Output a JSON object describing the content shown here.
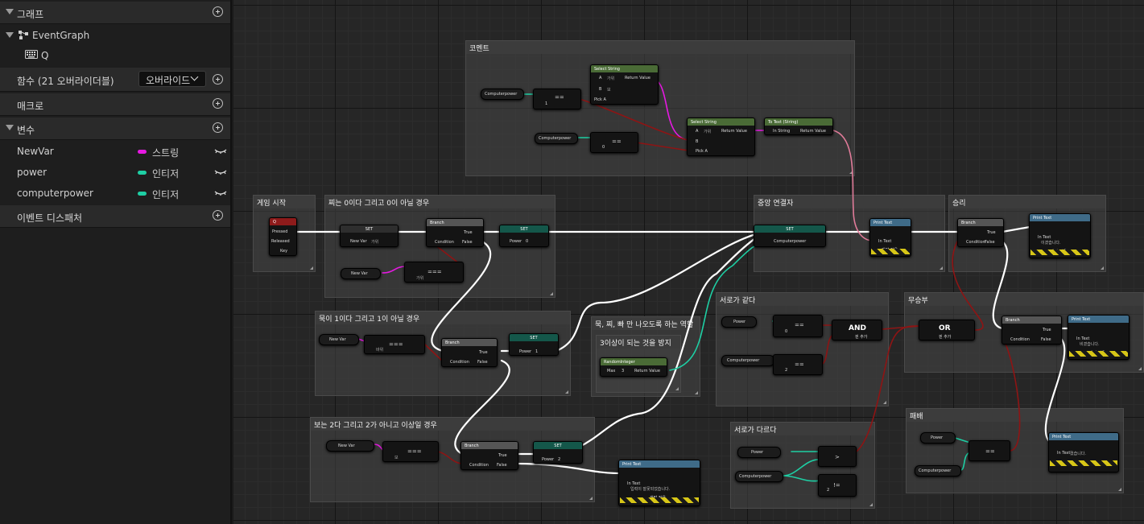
{
  "sidebar": {
    "graph_section": "그래프",
    "event_graph": "EventGraph",
    "q_event": "Q",
    "functions_section": "함수 (21 오버라이더블)",
    "override_label": "오버라이드",
    "macros_section": "매크로",
    "variables_section": "변수",
    "variables": [
      {
        "name": "NewVar",
        "type": "스트링",
        "color": "#e619e2"
      },
      {
        "name": "power",
        "type": "인티저",
        "color": "#1ecfa4"
      },
      {
        "name": "computerpower",
        "type": "인티저",
        "color": "#1ecfa4"
      }
    ],
    "dispatchers_section": "이벤트 디스패처"
  },
  "comments": {
    "c1": "코멘트",
    "c2": "게임 시작",
    "c3": "찌는 0이다 그리고 0이 아닐 경우",
    "c4": "중앙 연결자",
    "c5": "승리",
    "c6": "묵이 1이다 그리고 1이 아닐 경우",
    "c7": "묵, 찌, 빠 만 나오도록 하는 역할",
    "c8": "3이상이 되는 것을 방지",
    "c9": "서로가 같다",
    "c10": "무승부",
    "c11": "보는 2다 그리고 2가 아니고 이상일 경우",
    "c12": "서로가 다르다",
    "c13": "패배"
  },
  "nodes": {
    "select_string": "Select String",
    "to_text": "To Text (String)",
    "branch": "Branch",
    "set": "SET",
    "print_text": "Print Text",
    "random_integer": "RandomInteger",
    "q_key": "Q",
    "pressed": "Pressed",
    "released": "Released",
    "key": "Key",
    "computerpower": "Computerpower",
    "power": "Power",
    "new_var": "New Var",
    "return_value": "Return Value",
    "pin_a": "A",
    "pin_b": "B",
    "pick_a": "Pick A",
    "in_string": "In String",
    "in_text": "In Text",
    "condition": "Condition",
    "true_label": "True",
    "false_label": "False",
    "max": "Max",
    "equals": "==",
    "str_equals": "===",
    "greater": ">",
    "not_equal": "!=",
    "and_label": "AND",
    "or_label": "OR",
    "add_pin": "핀 추가",
    "dev_only": "개발 전용",
    "val_0": "0",
    "val_1": "1",
    "val_2": "2",
    "val_3": "3",
    "win_text": "이겼습니다.",
    "draw_text": "비겼습니다.",
    "lose_text": "졌습니다.",
    "error_text": "입력이 잘못되었습니다.",
    "str_gawi": "가위",
    "str_bawi": "바위",
    "str_bo": "보"
  }
}
